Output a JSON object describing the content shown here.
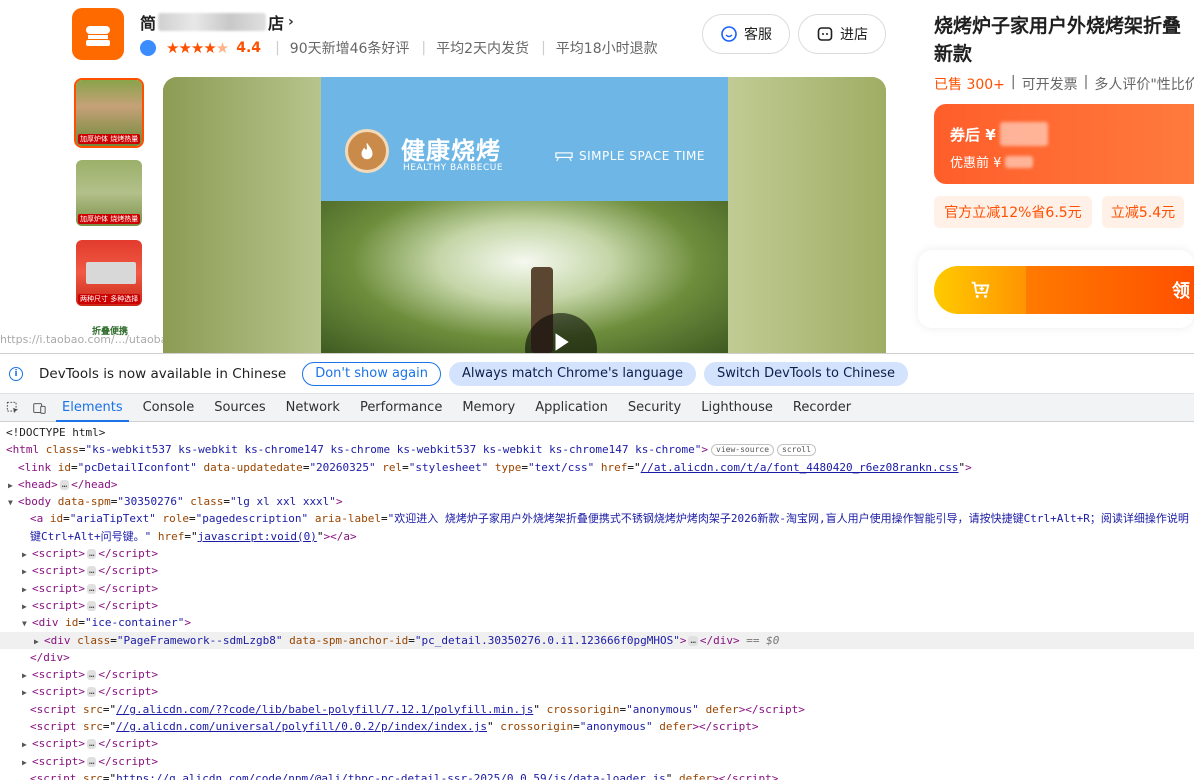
{
  "shop": {
    "name_start": "简",
    "name_end": "店",
    "chevron": "›",
    "rating": "4.4",
    "stats": [
      "90天新增46条好评",
      "平均2天内发货",
      "平均18小时退款"
    ],
    "service_label": "客服",
    "store_label": "进店"
  },
  "hero": {
    "title": "健康烧烤",
    "subtitle": "HEALTHY BARBECUE",
    "tagline": "SIMPLE SPACE TIME"
  },
  "thumbs": [
    {
      "caption": "加厚炉体 烧烤热量"
    },
    {
      "caption": "加厚炉体 烧烤热量"
    },
    {
      "caption": "两种尺寸 多种选择"
    },
    {
      "caption": "折叠便携"
    }
  ],
  "footmark_url": "https://i.taobao.com/.../utaobao/itao-tool/footMark",
  "product": {
    "title": "烧烤炉子家用户外烧烤架折叠新款",
    "sold": "已售 300+",
    "invoice": "可开发票",
    "review_summary": "多人评价\"性比价",
    "coupon_after": "券后 ¥",
    "before_coupon": "优惠前 ¥",
    "tag_1": "官方立减12%省6.5元",
    "tag_2": "立减5.4元",
    "get_label": "领"
  },
  "colors": {
    "accent": "#ff5000",
    "brand_orange": "#ff6a00",
    "devtools_blue": "#1a73e8"
  },
  "devtools": {
    "info_text": "DevTools is now available in Chinese",
    "btn_dont_show": "Don't show again",
    "btn_match": "Always match Chrome's language",
    "btn_switch": "Switch DevTools to Chinese",
    "tabs": [
      "Elements",
      "Console",
      "Sources",
      "Network",
      "Performance",
      "Memory",
      "Application",
      "Security",
      "Lighthouse",
      "Recorder"
    ],
    "active_tab": "Elements",
    "dom": {
      "doctype": "<!DOCTYPE html>",
      "html_open": "<html",
      "html_class_val": "\"ks-webkit537 ks-webkit ks-chrome147 ks-chrome ks-webkit537 ks-webkit ks-chrome147 ks-chrome\"",
      "chip_view_source": "view-source",
      "chip_scroll": "scroll",
      "link_id_val": "\"pcDetailIconfont\"",
      "link_date_val": "\"20260325\"",
      "link_rel_val": "\"stylesheet\"",
      "link_type_val": "\"text/css\"",
      "link_href_val": "//at.alicdn.com/t/a/font_4480420_r6ez08rankn.css",
      "body_spm_val": "\"30350276\"",
      "body_class_val": "\"lg xl xxl xxxl\"",
      "a_id_val": "\"ariaTipText\"",
      "a_role_val": "\"pagedescription\"",
      "a_label_val": "\"欢迎进入 烧烤炉子家用户外烧烤架折叠便携式不锈钢烧烤炉烤肉架子2026新款-淘宝网,盲人用户使用操作智能引导，请按快捷键Ctrl+Alt+R；阅读详细操作说明",
      "a_label_cont": "键Ctrl+Alt+问号键。\"",
      "a_href_val": "javascript:void(0)",
      "div_id_val": "\"ice-container\"",
      "div_class_val": "\"PageFramework--sdmLzgb8\"",
      "div_anchor_val": "\"pc_detail.30350276.0.i1.123666f0pgMHOS\"",
      "eq_dollar": "== $0",
      "script_babel": "//g.alicdn.com/??code/lib/babel-polyfill/7.12.1/polyfill.min.js",
      "script_universal": "//g.alicdn.com/universal/polyfill/0.0.2/p/index/index.js",
      "script_loader": "https://g.alicdn.com/code/npm/@ali/tbpc-pc-detail-ssr-2025/0.0.59/js/data-loader.js",
      "crossorigin_val": "\"anonymous\""
    }
  }
}
